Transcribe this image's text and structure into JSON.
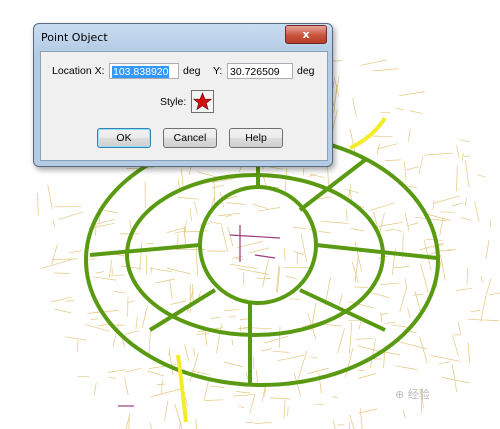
{
  "dialog": {
    "title": "Point Object",
    "close_label": "x",
    "location_label": "Location X:",
    "x_value": "103.838920",
    "x_unit": "deg",
    "y_label": "Y:",
    "y_value": "30.726509",
    "y_unit": "deg",
    "style_label": "Style:",
    "style_icon": "red-star-icon",
    "ok_label": "OK",
    "cancel_label": "Cancel",
    "help_label": "Help"
  },
  "map": {
    "colors": {
      "minor_roads": "#e3c77f",
      "major_roads": "#5a9a12",
      "highway": "#f2ec2a",
      "special": "#9b3d7a"
    }
  }
}
